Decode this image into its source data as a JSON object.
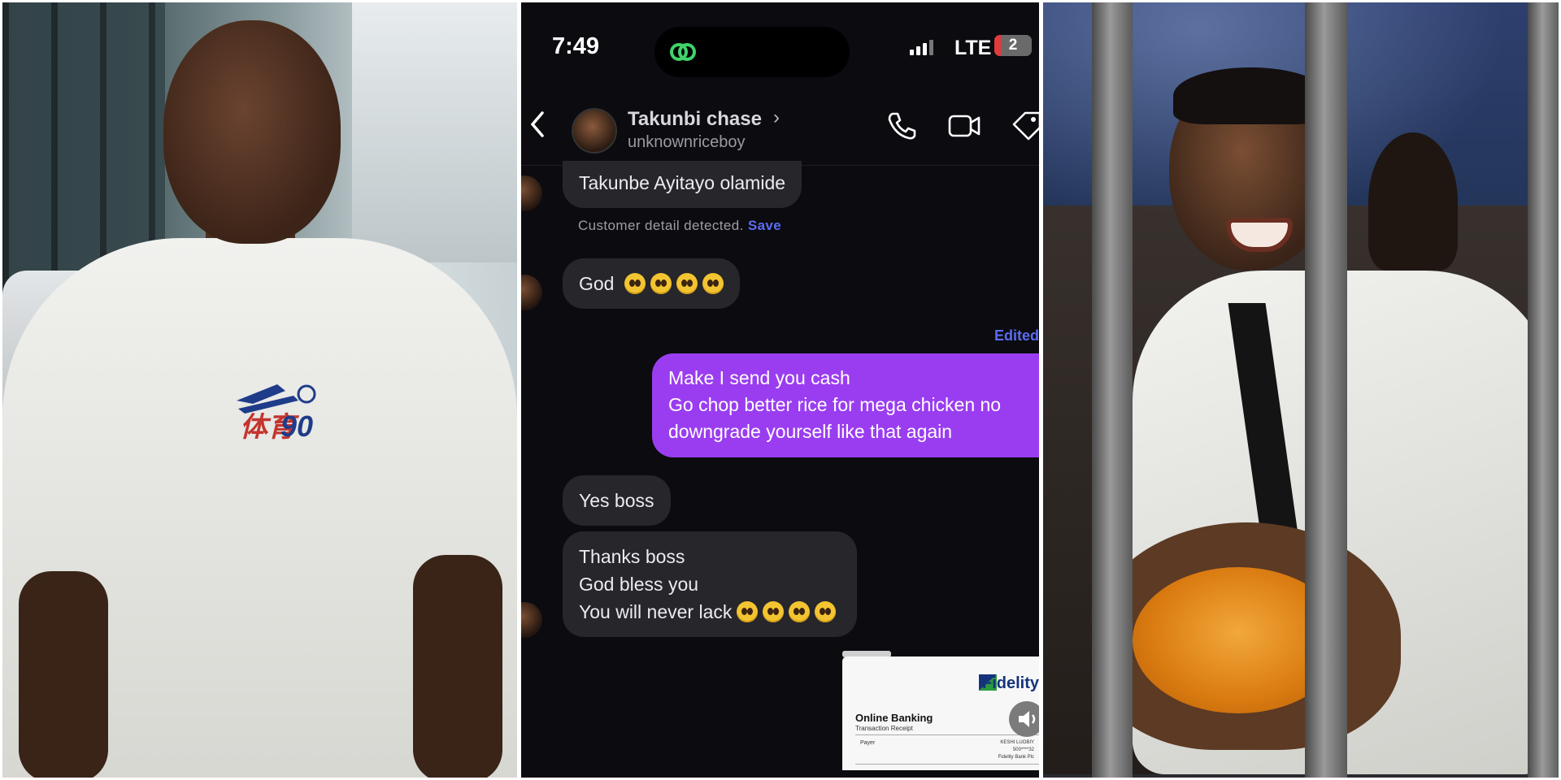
{
  "status_bar": {
    "time": "7:49",
    "network": "LTE",
    "battery": "2"
  },
  "chat": {
    "contact_name": "Takunbi chase",
    "contact_username": "unknownriceboy",
    "messages": [
      {
        "id": "m1",
        "from": "contact",
        "text": "Takunbe Ayitayo olamide"
      },
      {
        "id": "m2",
        "from": "contact",
        "text": "God",
        "emoji_count": 4
      },
      {
        "id": "m3",
        "from": "me",
        "lines": [
          "Make I send you cash",
          "Go chop better rice  for mega chicken no",
          "downgrade yourself like that again"
        ]
      },
      {
        "id": "m4",
        "from": "contact",
        "text": "Yes boss"
      },
      {
        "id": "m5",
        "from": "contact",
        "lines": [
          "Thanks boss",
          "God bless you",
          "You will never lack"
        ],
        "emoji_count": 4
      }
    ],
    "customer_detail": {
      "text": "Customer detail detected.",
      "action": "Save"
    },
    "edited_label": "Edited",
    "receipt": {
      "brand": "Fidelity",
      "title": "Online Banking",
      "subtitle": "Transaction Receipt",
      "payer_label": "Payer",
      "payer_value": "KESHI LUOBIY",
      "account_value": "500****32",
      "bank_value": "Fidelity Bank Plc"
    }
  },
  "photos": {
    "left_shirt_logo": "90"
  },
  "colors": {
    "sent_bubble": "#9a3df0",
    "received_bubble": "#26262b",
    "link": "#5b6cf0",
    "background": "#0b0b10"
  }
}
